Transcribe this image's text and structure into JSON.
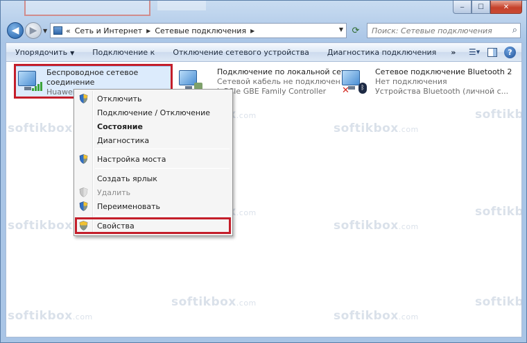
{
  "window": {
    "minimize": "‒",
    "maximize": "☐",
    "close": "✕"
  },
  "address": {
    "root_arrow": "«",
    "crumbs": [
      "Сеть и Интернет",
      "Сетевые подключения"
    ],
    "search_placeholder": "Поиск: Сетевые подключения"
  },
  "toolbar": {
    "organize": "Упорядочить",
    "connect": "Подключение к",
    "disable": "Отключение сетевого устройства",
    "diagnose": "Диагностика подключения",
    "more": "»"
  },
  "connections": [
    {
      "name": "Беспроводное сетевое",
      "name2": "соединение",
      "sub": "Huawei",
      "icon": "wireless-network-icon"
    },
    {
      "name": "Подключение по локальной сети",
      "sub": "Сетевой кабель не подключен",
      "sub2": "k PCIe GBE Family Controller",
      "icon": "wired-network-icon"
    },
    {
      "name": "Сетевое подключение Bluetooth 2",
      "sub": "Нет подключения",
      "sub2": "Устройства Bluetooth (личной с...",
      "icon": "bluetooth-network-icon"
    }
  ],
  "context_menu": {
    "items": [
      {
        "label": "Отключить",
        "shield": true
      },
      {
        "label": "Подключение / Отключение"
      },
      {
        "label": "Состояние",
        "bold": true
      },
      {
        "label": "Диагностика"
      },
      {
        "label": "Настройка моста",
        "shield": true
      },
      {
        "label": "Создать ярлык"
      },
      {
        "label": "Удалить",
        "shield": true,
        "disabled": true
      },
      {
        "label": "Переименовать",
        "shield": true
      },
      {
        "label": "Свойства",
        "shield": true
      }
    ]
  },
  "watermark": {
    "text": "softikbox",
    "suffix": ".com"
  },
  "colors": {
    "highlight": "#c41e2a",
    "selection": "#dcebfc"
  }
}
